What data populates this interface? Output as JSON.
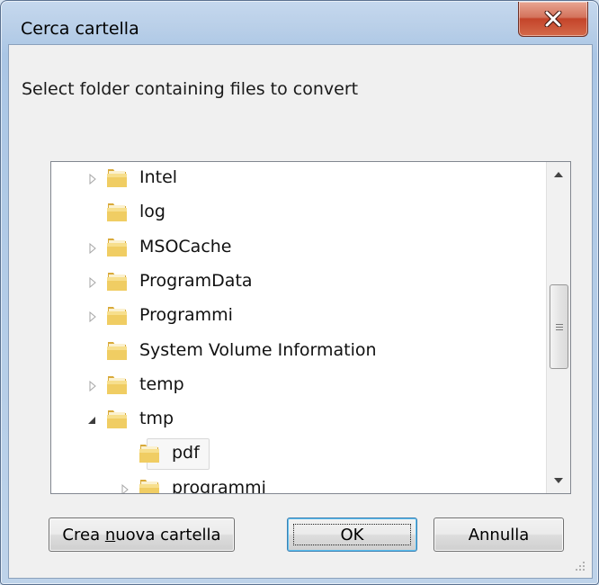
{
  "window": {
    "title": "Cerca cartella"
  },
  "dialog": {
    "prompt": "Select folder containing files to convert"
  },
  "tree": {
    "items": [
      {
        "label": "Intel",
        "expander": "collapsed",
        "level": 1
      },
      {
        "label": "log",
        "expander": "none",
        "level": 1
      },
      {
        "label": "MSOCache",
        "expander": "collapsed",
        "level": 1
      },
      {
        "label": "ProgramData",
        "expander": "collapsed",
        "level": 1
      },
      {
        "label": "Programmi",
        "expander": "collapsed",
        "level": 1
      },
      {
        "label": "System Volume Information",
        "expander": "none",
        "level": 1
      },
      {
        "label": "temp",
        "expander": "collapsed",
        "level": 1
      },
      {
        "label": "tmp",
        "expander": "expanded",
        "level": 1
      },
      {
        "label": "pdf",
        "expander": "none",
        "level": 2,
        "selected": true
      },
      {
        "label": "programmi",
        "expander": "collapsed",
        "level": 2
      }
    ]
  },
  "buttons": {
    "new_folder_prefix": "Crea ",
    "new_folder_mnemonic": "n",
    "new_folder_suffix": "uova cartella",
    "ok": "OK",
    "cancel": "Annulla"
  },
  "colors": {
    "close_button": "#c4442a",
    "folder": "#e9c55a",
    "default_button_border": "#3c7fb1"
  },
  "icons": {
    "close": "close-x-icon",
    "folder": "folder-icon",
    "expand_collapsed": "triangle-right-icon",
    "expand_expanded": "triangle-down-icon",
    "scroll_up": "scroll-up-arrow-icon",
    "scroll_down": "scroll-down-arrow-icon",
    "grip": "resize-grip-icon"
  }
}
